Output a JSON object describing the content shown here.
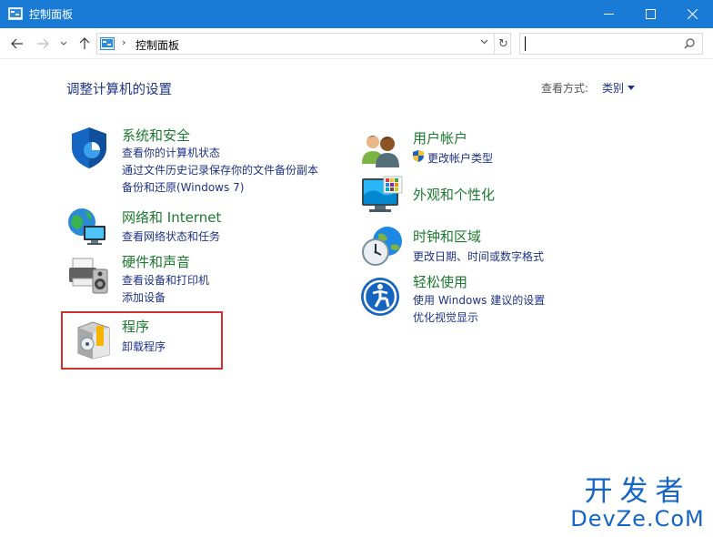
{
  "window": {
    "title": "控制面板",
    "accent": "#1a7bd6"
  },
  "nav": {
    "breadcrumb": "控制面板",
    "search_placeholder": "",
    "refresh_glyph": "↻"
  },
  "main": {
    "heading": "调整计算机的设置",
    "view_by_label": "查看方式:",
    "view_by_value": "类别"
  },
  "categories": {
    "system": {
      "title": "系统和安全",
      "links": [
        "查看你的计算机状态",
        "通过文件历史记录保存你的文件备份副本",
        "备份和还原(Windows 7)"
      ]
    },
    "network": {
      "title": "网络和 Internet",
      "links": [
        "查看网络状态和任务"
      ]
    },
    "hardware": {
      "title": "硬件和声音",
      "links": [
        "查看设备和打印机",
        "添加设备"
      ]
    },
    "programs": {
      "title": "程序",
      "links": [
        "卸载程序"
      ]
    },
    "users": {
      "title": "用户帐户",
      "links": [
        "更改帐户类型"
      ]
    },
    "appearance": {
      "title": "外观和个性化",
      "links": []
    },
    "clock": {
      "title": "时钟和区域",
      "links": [
        "更改日期、时间或数字格式"
      ]
    },
    "ease": {
      "title": "轻松使用",
      "links": [
        "使用 Windows 建议的设置",
        "优化视觉显示"
      ]
    }
  },
  "watermark": {
    "line1": "开发者",
    "line2": "DevZe.CoM"
  }
}
